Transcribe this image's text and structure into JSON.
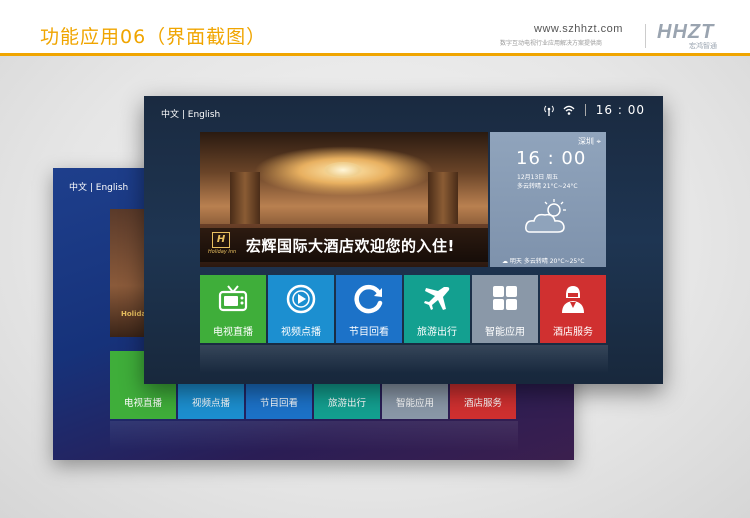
{
  "header": {
    "title": "功能应用06（界面截图）",
    "url": "www.szhhzt.com",
    "tagline": "数字互动电视行业应用解决方案提供商",
    "logo_mark": "HHZT",
    "logo_sub": "宏鸿智通",
    "accent_color": "#f0a500"
  },
  "back_screen": {
    "lang_switch": "中文 | English",
    "brand_text": "Holiday Inn",
    "tiles": [
      {
        "label": "电视直播",
        "color": "#3fae3a"
      },
      {
        "label": "视频点播",
        "color": "#1c8fd0"
      },
      {
        "label": "节目回看",
        "color": "#1c72c8"
      },
      {
        "label": "旅游出行",
        "color": "#13a090"
      },
      {
        "label": "智能应用",
        "color": "#8a98a8"
      },
      {
        "label": "酒店服务",
        "color": "#d03030"
      }
    ]
  },
  "front_screen": {
    "lang_switch": "中文 | English",
    "status": {
      "clock": "16 : 00",
      "icons": [
        "antenna-icon",
        "wifi-icon"
      ]
    },
    "banner": {
      "hotel_logo_mark": "H",
      "hotel_logo_text": "Holiday Inn",
      "welcome_text": "宏辉国际大酒店欢迎您的入住!"
    },
    "weather": {
      "city": "深圳",
      "time": "16 : 00",
      "date": "12月13日 周五",
      "condition": "多云转晴 21°C~24°C",
      "tomorrow": "明天   多云转晴   20°C~25°C",
      "icon": "cloud-sun-icon"
    },
    "tiles": [
      {
        "key": "tv",
        "label": "电视直播",
        "color": "#3fae3a",
        "icon": "tv-icon"
      },
      {
        "key": "vod",
        "label": "视频点播",
        "color": "#1c8fd0",
        "icon": "play-icon"
      },
      {
        "key": "replay",
        "label": "节目回看",
        "color": "#1c72c8",
        "icon": "replay-icon"
      },
      {
        "key": "travel",
        "label": "旅游出行",
        "color": "#13a090",
        "icon": "airplane-icon"
      },
      {
        "key": "apps",
        "label": "智能应用",
        "color": "#8a98a8",
        "icon": "grid-icon"
      },
      {
        "key": "service",
        "label": "酒店服务",
        "color": "#d03030",
        "icon": "concierge-icon"
      }
    ]
  }
}
